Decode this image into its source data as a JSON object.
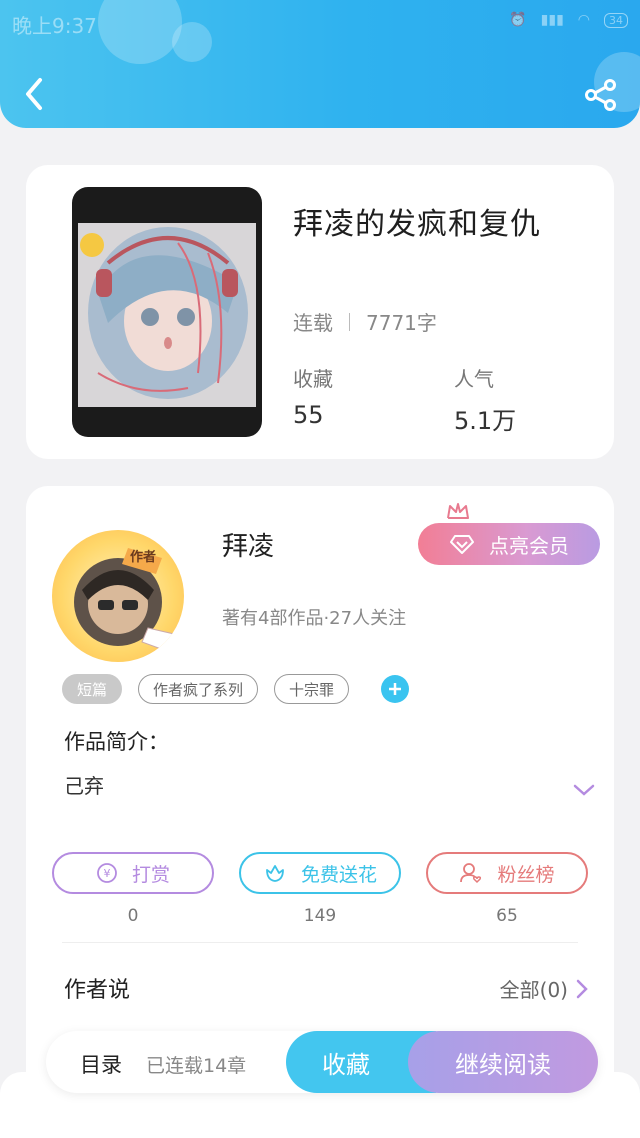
{
  "status_bar": {
    "time": "晚上9:37",
    "battery": "34"
  },
  "book": {
    "title": "拜凌的发疯和复仇",
    "status": "连载",
    "word_count": "7771字",
    "stats": [
      {
        "label": "收藏",
        "value": "55"
      },
      {
        "label": "人气",
        "value": "5.1万"
      }
    ]
  },
  "author": {
    "badge": "作者",
    "name": "拜凌",
    "subtitle": "著有4部作品·27人关注",
    "vip_button": "点亮会员"
  },
  "tags": [
    "短篇",
    "作者疯了系列",
    "十宗罪"
  ],
  "intro": {
    "heading": "作品简介：",
    "text": "己弃"
  },
  "actions": [
    {
      "label": "打赏",
      "count": "0",
      "color": "#b48be0"
    },
    {
      "label": "免费送花",
      "count": "149",
      "color": "#3cc3e8"
    },
    {
      "label": "粉丝榜",
      "count": "65",
      "color": "#e57b7b"
    }
  ],
  "author_says": {
    "heading": "作者说",
    "all": "全部(0)"
  },
  "bottom": {
    "toc": "目录",
    "chapters": "已连载14章",
    "favorite": "收藏",
    "continue": "继续阅读"
  }
}
